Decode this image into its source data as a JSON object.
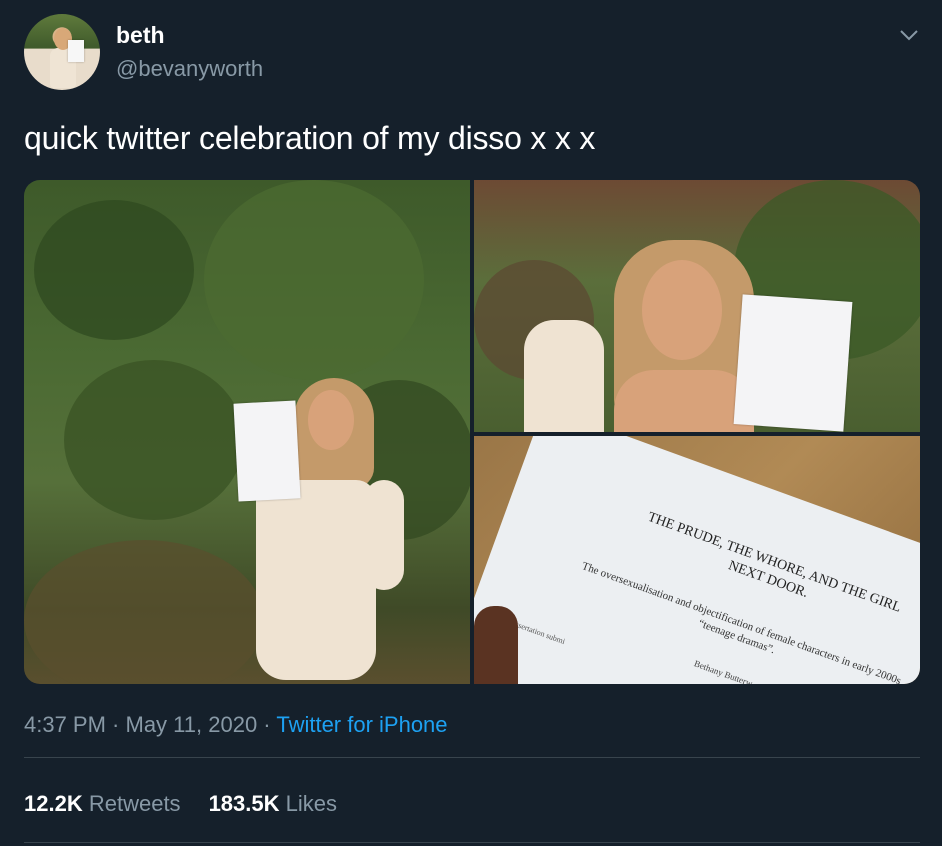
{
  "user": {
    "display_name": "beth",
    "handle": "@bevanyworth",
    "avatar_icon": "profile-photo"
  },
  "tweet": {
    "text": "quick twitter celebration of my disso x x x"
  },
  "media": {
    "document": {
      "title": "THE PRUDE, THE WHORE, AND THE GIRL NEXT DOOR.",
      "subtitle": "The oversexualisation and objectification of female characters in early 2000s “teenage dramas”.",
      "author": "Bethany Butterw",
      "submission_text": "Dissertation submi"
    }
  },
  "meta": {
    "time": "4:37 PM",
    "separator1": " · ",
    "date": "May 11, 2020",
    "separator2": " · ",
    "source": "Twitter for iPhone"
  },
  "stats": {
    "retweets_count": "12.2K",
    "retweets_label": "Retweets",
    "likes_count": "183.5K",
    "likes_label": "Likes"
  },
  "colors": {
    "background": "#15202b",
    "secondary_text": "#8899a6",
    "link": "#1da1f2",
    "divider": "#38444d"
  },
  "icons": {
    "menu": "chevron-down-icon"
  }
}
